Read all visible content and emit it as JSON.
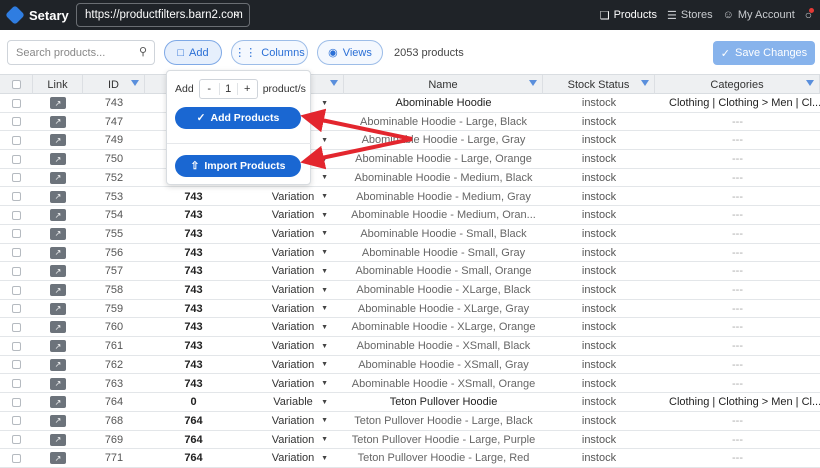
{
  "topbar": {
    "brand": "Setary",
    "site_url": "https://productfilters.barn2.com",
    "nav": [
      {
        "label": "Products",
        "icon": "cube-icon",
        "active": true
      },
      {
        "label": "Stores",
        "icon": "stack-icon",
        "active": false
      },
      {
        "label": "My Account",
        "icon": "user-icon",
        "active": false
      }
    ]
  },
  "toolbar": {
    "search_placeholder": "Search products...",
    "add_label": "Add",
    "columns_label": "Columns",
    "views_label": "Views",
    "product_count": "2053 products",
    "save_label": "Save Changes"
  },
  "popover": {
    "add_prefix": "Add",
    "minus": "-",
    "quantity": "1",
    "plus": "+",
    "suffix": "product/s",
    "add_products_label": "Add Products",
    "import_products_label": "Import Products"
  },
  "table": {
    "headers": [
      "Link",
      "ID",
      "",
      "",
      "Name",
      "Stock Status",
      "Categories"
    ],
    "rows": [
      {
        "id": "743",
        "parent": "",
        "type": "",
        "name": "Abominable Hoodie",
        "stock": "instock",
        "cat": "Clothing | Clothing > Men | Cl...",
        "is_parent": true
      },
      {
        "id": "747",
        "parent": "",
        "type": "",
        "name": "Abominable Hoodie - Large, Black",
        "stock": "instock",
        "cat": "---",
        "is_parent": false
      },
      {
        "id": "749",
        "parent": "",
        "type": "",
        "name": "Abominable Hoodie - Large, Gray",
        "stock": "instock",
        "cat": "---",
        "is_parent": false
      },
      {
        "id": "750",
        "parent": "",
        "type": "",
        "name": "Abominable Hoodie - Large, Orange",
        "stock": "instock",
        "cat": "---",
        "is_parent": false
      },
      {
        "id": "752",
        "parent": "",
        "type": "",
        "name": "Abominable Hoodie - Medium, Black",
        "stock": "instock",
        "cat": "---",
        "is_parent": false
      },
      {
        "id": "753",
        "parent": "743",
        "type": "Variation",
        "name": "Abominable Hoodie - Medium, Gray",
        "stock": "instock",
        "cat": "---",
        "is_parent": false
      },
      {
        "id": "754",
        "parent": "743",
        "type": "Variation",
        "name": "Abominable Hoodie - Medium, Oran...",
        "stock": "instock",
        "cat": "---",
        "is_parent": false
      },
      {
        "id": "755",
        "parent": "743",
        "type": "Variation",
        "name": "Abominable Hoodie - Small, Black",
        "stock": "instock",
        "cat": "---",
        "is_parent": false
      },
      {
        "id": "756",
        "parent": "743",
        "type": "Variation",
        "name": "Abominable Hoodie - Small, Gray",
        "stock": "instock",
        "cat": "---",
        "is_parent": false
      },
      {
        "id": "757",
        "parent": "743",
        "type": "Variation",
        "name": "Abominable Hoodie - Small, Orange",
        "stock": "instock",
        "cat": "---",
        "is_parent": false
      },
      {
        "id": "758",
        "parent": "743",
        "type": "Variation",
        "name": "Abominable Hoodie - XLarge, Black",
        "stock": "instock",
        "cat": "---",
        "is_parent": false
      },
      {
        "id": "759",
        "parent": "743",
        "type": "Variation",
        "name": "Abominable Hoodie - XLarge, Gray",
        "stock": "instock",
        "cat": "---",
        "is_parent": false
      },
      {
        "id": "760",
        "parent": "743",
        "type": "Variation",
        "name": "Abominable Hoodie - XLarge, Orange",
        "stock": "instock",
        "cat": "---",
        "is_parent": false
      },
      {
        "id": "761",
        "parent": "743",
        "type": "Variation",
        "name": "Abominable Hoodie - XSmall, Black",
        "stock": "instock",
        "cat": "---",
        "is_parent": false
      },
      {
        "id": "762",
        "parent": "743",
        "type": "Variation",
        "name": "Abominable Hoodie - XSmall, Gray",
        "stock": "instock",
        "cat": "---",
        "is_parent": false
      },
      {
        "id": "763",
        "parent": "743",
        "type": "Variation",
        "name": "Abominable Hoodie - XSmall, Orange",
        "stock": "instock",
        "cat": "---",
        "is_parent": false
      },
      {
        "id": "764",
        "parent": "0",
        "type": "Variable",
        "name": "Teton Pullover Hoodie",
        "stock": "instock",
        "cat": "Clothing | Clothing > Men | Cl...",
        "is_parent": true
      },
      {
        "id": "768",
        "parent": "764",
        "type": "Variation",
        "name": "Teton Pullover Hoodie - Large, Black",
        "stock": "instock",
        "cat": "---",
        "is_parent": false
      },
      {
        "id": "769",
        "parent": "764",
        "type": "Variation",
        "name": "Teton Pullover Hoodie - Large, Purple",
        "stock": "instock",
        "cat": "---",
        "is_parent": false
      },
      {
        "id": "771",
        "parent": "764",
        "type": "Variation",
        "name": "Teton Pullover Hoodie - Large, Red",
        "stock": "instock",
        "cat": "---",
        "is_parent": false
      }
    ]
  },
  "colors": {
    "topbar_bg": "#1f2328",
    "accent": "#1a67d2",
    "arrow": "#e3262e"
  }
}
